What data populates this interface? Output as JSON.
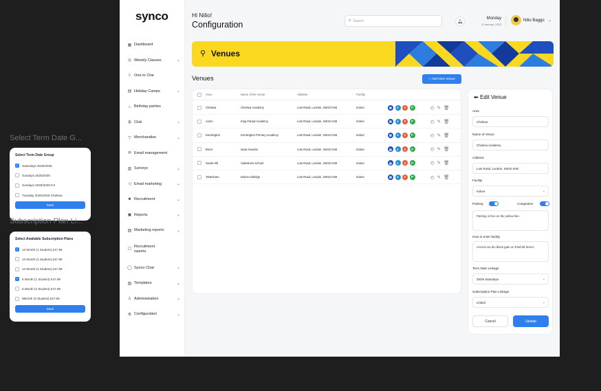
{
  "left_panels": {
    "term_label": "Select Term Date G...",
    "term_card_title": "Select Term Date Group",
    "term_options": [
      {
        "label": "Saturdays 2025/2026",
        "checked": true
      },
      {
        "label": "Sundays 2025/2026",
        "checked": false
      },
      {
        "label": "Sundays 2025/2026 KX",
        "checked": false
      },
      {
        "label": "Tuesday 2025/2026 Chelsea",
        "checked": false
      }
    ],
    "term_save": "Save",
    "sub_label": "Subscription Plan Li...",
    "sub_card_title": "Select Available Subscription Plans",
    "sub_options": [
      {
        "label": "12 Month (1 Student) £47.99",
        "checked": true
      },
      {
        "label": "12 Month (2 Student) £47.99",
        "checked": false
      },
      {
        "label": "12 Month (3 Student) £47.99",
        "checked": false
      },
      {
        "label": "6 Month (1 Student) £47.99",
        "checked": true
      },
      {
        "label": "6 Month (2 Student) £47.99",
        "checked": false
      },
      {
        "label": "6Month (3 Student) £47.99",
        "checked": false
      }
    ],
    "sub_save": "Save"
  },
  "sidebar": {
    "logo": "synco",
    "items": [
      {
        "label": "Dashboard",
        "icon": "grid-icon",
        "chevron": false
      },
      {
        "label": "Weekly Classes",
        "icon": "globe-icon",
        "chevron": true
      },
      {
        "label": "One to One",
        "icon": "user-icon",
        "chevron": false
      },
      {
        "label": "Holiday Camps",
        "icon": "calendar-icon",
        "chevron": true
      },
      {
        "label": "Birthday parties",
        "icon": "cake-icon",
        "chevron": false
      },
      {
        "label": "Club",
        "icon": "ball-icon",
        "chevron": true
      },
      {
        "label": "Merchandise",
        "icon": "shirt-icon",
        "chevron": true
      },
      {
        "label": "Email management",
        "icon": "mail-icon",
        "chevron": false
      },
      {
        "label": "Surveys",
        "icon": "clipboard-icon",
        "chevron": true
      },
      {
        "label": "Email marketing",
        "icon": "megaphone-icon",
        "chevron": true
      },
      {
        "label": "Recruitment",
        "icon": "people-icon",
        "chevron": true
      },
      {
        "label": "Reports",
        "icon": "report-icon",
        "chevron": true
      },
      {
        "label": "Marketing reports",
        "icon": "chart-icon",
        "chevron": true
      },
      {
        "label": "Recruitment reports",
        "icon": "doc-icon",
        "chevron": false
      },
      {
        "label": "Synco Chat",
        "icon": "chat-icon",
        "chevron": true
      },
      {
        "label": "Templates",
        "icon": "template-icon",
        "chevron": true
      },
      {
        "label": "Administration",
        "icon": "admin-icon",
        "chevron": true
      },
      {
        "label": "Configuration",
        "icon": "cog-icon",
        "chevron": true
      }
    ]
  },
  "header": {
    "greeting": "Hi Nilio!",
    "title": "Configuration",
    "search_placeholder": "Search",
    "day": "Monday",
    "date": "8 January, 2023",
    "user_name": "Nilio Baggo"
  },
  "banner": {
    "title": "Venues",
    "colors": [
      "#f9d81f",
      "#1f4fbf",
      "#2d7de0",
      "#113a9a"
    ]
  },
  "venues": {
    "title": "Venues",
    "add_button": "Add New Venue",
    "columns": [
      "Area",
      "Name of the venue",
      "Address",
      "Facility"
    ],
    "rows": [
      {
        "area": "Chelsea",
        "name": "Chelsea Academy",
        "address": "Lots Road, London, SW10 0AB",
        "facility": "Indoor"
      },
      {
        "area": "Acton",
        "name": "King Fahad Academy",
        "address": "Lots Road, London, SW10 0AB",
        "facility": "Indoor"
      },
      {
        "area": "Kensington",
        "name": "Kensington Primary Academy",
        "address": "Lots Road, London, SW10 0AB",
        "facility": "Indoor"
      },
      {
        "area": "Brent",
        "name": "Isaac Newton",
        "address": "Lots Road, London, SW10 0AB",
        "facility": "Indoor"
      },
      {
        "area": "Gants Hill",
        "name": "Valentines School",
        "address": "Lots Road, London, SW10 0AB",
        "facility": "Indoor"
      },
      {
        "area": "Tottenham",
        "name": "Dukes Aldridge",
        "address": "Lots Road, London, SW10 0AB",
        "facility": "Indoor"
      }
    ],
    "row_icons": [
      {
        "glyph": "▤",
        "color": "#1f4fbf",
        "name": "calendar-badge-icon"
      },
      {
        "glyph": "£",
        "color": "#1e90d6",
        "name": "pound-badge-icon"
      },
      {
        "glyph": "C",
        "color": "#ef5a2f",
        "name": "congestion-badge-icon"
      },
      {
        "glyph": "P",
        "color": "#2fa84f",
        "name": "parking-badge-icon"
      }
    ]
  },
  "edit_venue": {
    "title": "Edit Venue",
    "area_label": "Area",
    "area_value": "Chelsea",
    "name_label": "Name of Venue",
    "name_value": "Chelsea Academy",
    "address_label": "Address",
    "address_value": "Lots Road, London, SW10 0AB",
    "facility_label": "Facility",
    "facility_value": "Indoor",
    "parking_label": "Parking",
    "congestion_label": "Congestion",
    "parking_note": "Parking is free on the yellow line.",
    "enter_label": "How to enter facility",
    "enter_note": "Access via the black gate on Panfold Street.",
    "term_label": "Term Date Linkage",
    "term_value": "25/26 Saturdays",
    "sub_label": "Subscription Plan Linkage",
    "sub_value": "Linked",
    "cancel": "Cancel",
    "update": "Update"
  }
}
